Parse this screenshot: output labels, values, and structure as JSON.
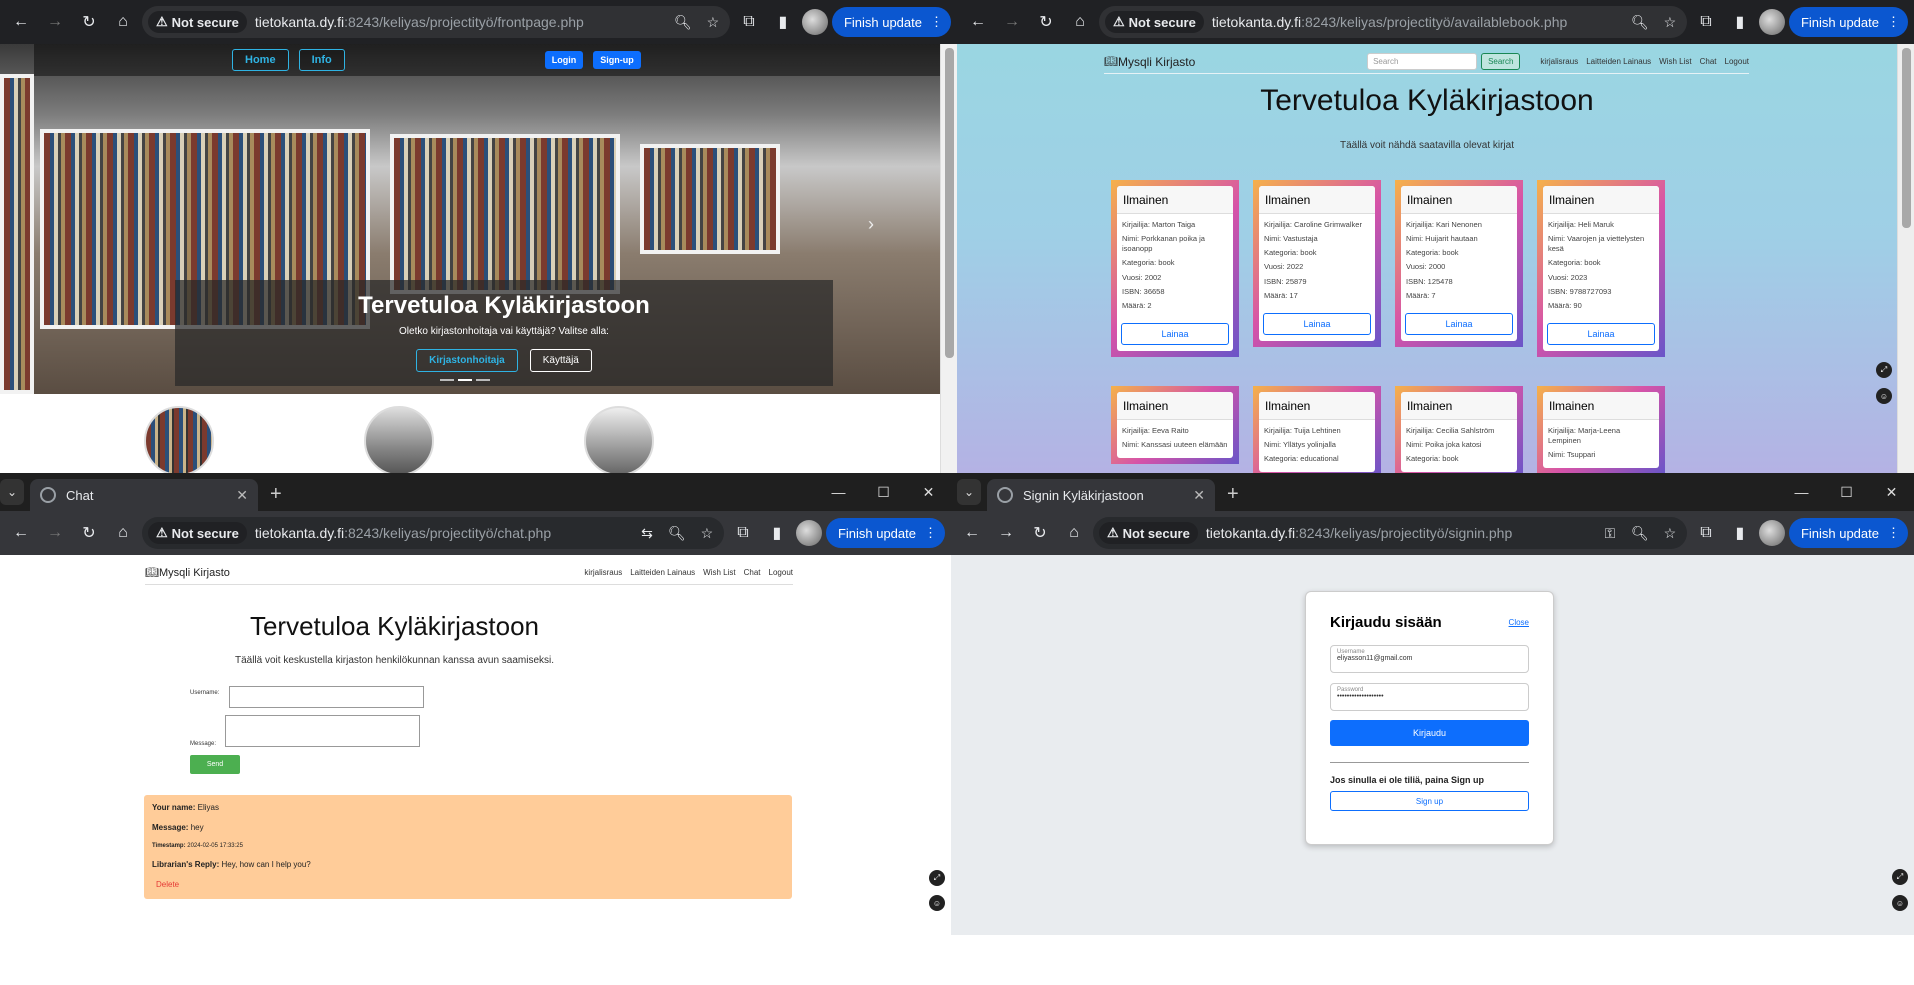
{
  "q1": {
    "security": "Not secure",
    "url_host": "tietokanta.dy.fi",
    "url_path": ":8243/keliyas/projectityö/frontpage.php",
    "finish_update": "Finish update",
    "nav": {
      "home": "Home",
      "info": "Info",
      "login": "Login",
      "signup": "Sign-up"
    },
    "caption": {
      "title": "Tervetuloa Kyläkirjastoon",
      "text": "Oletko kirjastonhoitaja vai käyttäjä? Valitse alla:",
      "btn_librarian": "Kirjastonhoitaja",
      "btn_user": "Käyttäjä"
    }
  },
  "q2": {
    "security": "Not secure",
    "url_host": "tietokanta.dy.fi",
    "url_path": ":8243/keliyas/projectityö/availablebook.php",
    "finish_update": "Finish update",
    "logo": "Mysqli Kirjasto",
    "search_placeholder": "Search",
    "search_button": "Search",
    "links": [
      "kirjalisraus",
      "Laitteiden Lainaus",
      "Wish List",
      "Chat",
      "Logout"
    ],
    "title": "Tervetuloa Kyläkirjastoon",
    "subtitle": "Täällä voit nähdä saatavilla olevat kirjat",
    "lainaa": "Lainaa",
    "cards": [
      {
        "head": "Ilmainen",
        "author": "Kirjailija: Marton Taiga",
        "name": "Nimi: Porkkanan poika ja isoanopp",
        "cat": "Kategoria: book",
        "year": "Vuosi: 2002",
        "isbn": "ISBN: 36658",
        "qty": "Määrä: 2"
      },
      {
        "head": "Ilmainen",
        "author": "Kirjailija: Caroline Grimwalker",
        "name": "Nimi: Vastustaja",
        "cat": "Kategoria: book",
        "year": "Vuosi: 2022",
        "isbn": "ISBN: 25879",
        "qty": "Määrä: 17"
      },
      {
        "head": "Ilmainen",
        "author": "Kirjailija: Kari Nenonen",
        "name": "Nimi: Huijarit hautaan",
        "cat": "Kategoria: book",
        "year": "Vuosi: 2000",
        "isbn": "ISBN: 125478",
        "qty": "Määrä: 7"
      },
      {
        "head": "Ilmainen",
        "author": "Kirjailija: Heli Maruk",
        "name": "Nimi: Vaarojen ja viettelysten kesä",
        "cat": "Kategoria: book",
        "year": "Vuosi: 2023",
        "isbn": "ISBN: 9788727093",
        "qty": "Määrä: 90"
      },
      {
        "head": "Ilmainen",
        "author": "Kirjailija: Eeva Raito",
        "name": "Nimi: Kanssasi uuteen elämään"
      },
      {
        "head": "Ilmainen",
        "author": "Kirjailija: Tuija Lehtinen",
        "name": "Nimi: Yllätys yolinjalla",
        "cat": "Kategoria: educational"
      },
      {
        "head": "Ilmainen",
        "author": "Kirjailija: Cecilia Sahlström",
        "name": "Nimi: Poika joka katosi",
        "cat": "Kategoria: book"
      },
      {
        "head": "Ilmainen",
        "author": "Kirjailija: Marja-Leena Lempinen",
        "name": "Nimi: Tsuppari"
      }
    ]
  },
  "q3": {
    "tab_title": "Chat",
    "security": "Not secure",
    "url_host": "tietokanta.dy.fi",
    "url_path": ":8243/keliyas/projectityö/chat.php",
    "finish_update": "Finish update",
    "logo": "Mysqli Kirjasto",
    "links": [
      "kirjalisraus",
      "Laitteiden Lainaus",
      "Wish List",
      "Chat",
      "Logout"
    ],
    "title": "Tervetuloa Kyläkirjastoon",
    "subtitle": "Täällä voit keskustella kirjaston henkilökunnan kanssa avun saamiseksi.",
    "username_label": "Username:",
    "message_label": "Message:",
    "send": "Send",
    "msg": {
      "name_label": "Your name:",
      "name": "Eliyas",
      "message_label": "Message:",
      "message": "hey",
      "ts_label": "Timestamp:",
      "ts": "2024-02-05 17:33:25",
      "reply_label": "Librarian's Reply:",
      "reply": "Hey, how can I help you?",
      "delete": "Delete"
    }
  },
  "q4": {
    "tab_title": "Signin Kyläkirjastoon",
    "security": "Not secure",
    "url_host": "tietokanta.dy.fi",
    "url_path": ":8243/keliyas/projectityö/signin.php",
    "finish_update": "Finish update",
    "title": "Kirjaudu sisään",
    "close": "Close",
    "username_label": "Username",
    "username_value": "eliyasson11@gmail.com",
    "password_label": "Password",
    "password_value": "•••••••••••••••••••",
    "login_button": "Kirjaudu",
    "no_account": "Jos sinulla ei ole tiliä, paina Sign up",
    "signup_button": "Sign up"
  }
}
